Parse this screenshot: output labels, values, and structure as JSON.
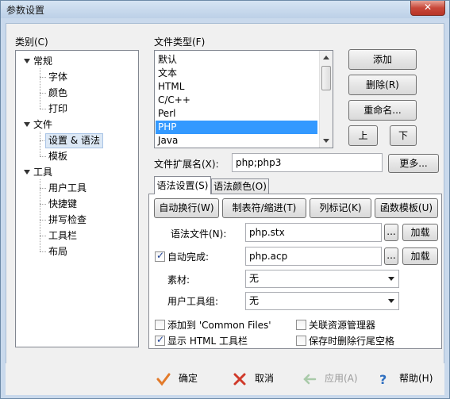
{
  "window": {
    "title": "参数设置",
    "close_glyph": "✕"
  },
  "category": {
    "label": "类别(C)",
    "tree": [
      {
        "label": "常规",
        "children": [
          "字体",
          "颜色",
          "打印"
        ]
      },
      {
        "label": "文件",
        "children": [
          "设置 & 语法",
          "模板"
        ],
        "selected_child": "设置 & 语法"
      },
      {
        "label": "工具",
        "children": [
          "用户工具",
          "快捷键",
          "拼写检查",
          "工具栏",
          "布局"
        ]
      }
    ]
  },
  "filetype": {
    "label": "文件类型(F)",
    "items": [
      "默认",
      "文本",
      "HTML",
      "C/C++",
      "Perl",
      "PHP",
      "Java"
    ],
    "selected": "PHP"
  },
  "buttons": {
    "add": "添加",
    "delete": "删除(R)",
    "rename": "重命名...",
    "up": "上",
    "down": "下",
    "more": "更多..."
  },
  "extension": {
    "label": "文件扩展名(X):",
    "value": "php;php3"
  },
  "tabs": {
    "syntax_settings": "语法设置(S)",
    "syntax_colors": "语法颜色(O)"
  },
  "syntax": {
    "auto_wrap": "自动换行(W)",
    "tab_indent": "制表符/缩进(T)",
    "column_marker": "列标记(K)",
    "function_template": "函数模板(U)",
    "syntax_file_label": "语法文件(N):",
    "syntax_file_value": "php.stx",
    "autocomplete_label": "自动完成:",
    "autocomplete_checked": true,
    "autocomplete_value": "php.acp",
    "browse": "...",
    "load": "加载",
    "material_label": "素材:",
    "material_value": "无",
    "usertool_label": "用户工具组:",
    "usertool_value": "无",
    "options": [
      {
        "label": "添加到 'Common Files'",
        "checked": false
      },
      {
        "label": "关联资源管理器",
        "checked": false
      },
      {
        "label": "显示 HTML 工具栏",
        "checked": true
      },
      {
        "label": "保存时删除行尾空格",
        "checked": false
      }
    ]
  },
  "footer": {
    "ok": "确定",
    "cancel": "取消",
    "apply": "应用(A)",
    "help": "帮助(H)"
  },
  "colors": {
    "ok": "#e27a2a",
    "cancel": "#d03a2a",
    "apply": "#7ab07a",
    "help": "#2f6fc0",
    "selection": "#3399ff"
  }
}
